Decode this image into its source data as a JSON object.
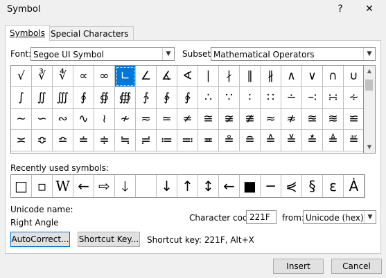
{
  "window": {
    "title": "Symbol",
    "help": "?",
    "close": "✕"
  },
  "tabs": [
    {
      "label": "Symbols",
      "active": true
    },
    {
      "label": "Special Characters",
      "active": false
    }
  ],
  "font": {
    "label": "Font:",
    "value": "Segoe UI Symbol"
  },
  "subset": {
    "label": "Subset:",
    "value": "Mathematical Operators"
  },
  "symbol_grid": {
    "rows": [
      [
        "√",
        "∛",
        "∜",
        "∝",
        "∞",
        "∟",
        "∠",
        "∡",
        "∢",
        "∣",
        "∤",
        "∥",
        "∦",
        "∧",
        "∨",
        "∩",
        "∪"
      ],
      [
        "∫",
        "∬",
        "∭",
        "∮",
        "∯",
        "∰",
        "∱",
        "∲",
        "∳",
        "∴",
        "∵",
        "∶",
        "∷",
        "∸",
        "∹",
        "∺",
        "∻"
      ],
      [
        "∼",
        "∽",
        "∾",
        "∿",
        "≀",
        "≁",
        "≂",
        "≃",
        "≄",
        "≅",
        "≆",
        "≇",
        "≈",
        "≉",
        "≊",
        "≋",
        "≌"
      ],
      [
        "≍",
        "≎",
        "≏",
        "≐",
        "≑",
        "≒",
        "≓",
        "≔",
        "≕",
        "≖",
        "≗",
        "≘",
        "≙",
        "≚",
        "≛",
        "≜",
        "≝"
      ]
    ],
    "selected": "∟"
  },
  "recent": {
    "label": "Recently used symbols:",
    "symbols": [
      "□",
      "▫",
      "W",
      "←",
      "⇨",
      "🡓",
      "",
      "↓",
      "↑",
      "↕",
      "←",
      "■",
      "─",
      "⋞",
      "§",
      "ε",
      "Ȧ"
    ]
  },
  "unicode_name": {
    "label": "Unicode name:",
    "value": "Right Angle"
  },
  "char_code": {
    "label": "Character code:",
    "value": "221F"
  },
  "from": {
    "label": "from:",
    "value": "Unicode (hex)"
  },
  "buttons": {
    "autocorrect": "AutoCorrect...",
    "shortcut_key": "Shortcut Key...",
    "insert": "Insert",
    "cancel": "Cancel"
  },
  "shortcut_text": "Shortcut key: 221F, Alt+X"
}
